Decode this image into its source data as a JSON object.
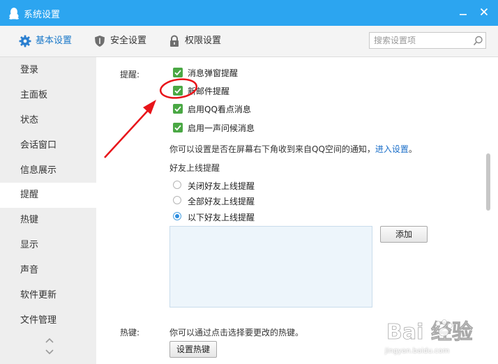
{
  "window": {
    "title": "系统设置"
  },
  "toolbar": {
    "tabs": [
      {
        "label": "基本设置",
        "icon": "gear-icon",
        "active": true
      },
      {
        "label": "安全设置",
        "icon": "shield-icon",
        "active": false
      },
      {
        "label": "权限设置",
        "icon": "lock-icon",
        "active": false
      }
    ],
    "search_placeholder": "搜索设置项"
  },
  "sidebar": {
    "items": [
      "登录",
      "主面板",
      "状态",
      "会话窗口",
      "信息展示",
      "提醒",
      "热键",
      "显示",
      "声音",
      "软件更新",
      "文件管理"
    ],
    "active_index": 5
  },
  "content": {
    "reminder_label": "提醒:",
    "checkboxes": [
      {
        "label": "消息弹窗提醒",
        "checked": true
      },
      {
        "label": "新邮件提醒",
        "checked": true
      },
      {
        "label": "启用QQ看点消息",
        "checked": true
      },
      {
        "label": "启用一声问候消息",
        "checked": true
      }
    ],
    "notify_text": "你可以设置是否在屏幕右下角收到来自QQ空间的通知，",
    "notify_link": "进入设置",
    "notify_end": "。",
    "friend_online_title": "好友上线提醒",
    "radios": [
      {
        "label": "关闭好友上线提醒",
        "checked": false
      },
      {
        "label": "全部好友上线提醒",
        "checked": false
      },
      {
        "label": "以下好友上线提醒",
        "checked": true
      }
    ],
    "add_button": "添加",
    "hotkey_label": "热键:",
    "hotkey_text": "你可以通过点击选择要更改的热键。",
    "hotkey_button": "设置热键"
  },
  "watermark": {
    "brand": "Bai 经验",
    "url": "jingyan.baidu.com"
  },
  "colors": {
    "titlebar": "#2ca5f0",
    "accent": "#1b79c9",
    "check_green": "#4aa844",
    "annotation_red": "#e8141a"
  }
}
